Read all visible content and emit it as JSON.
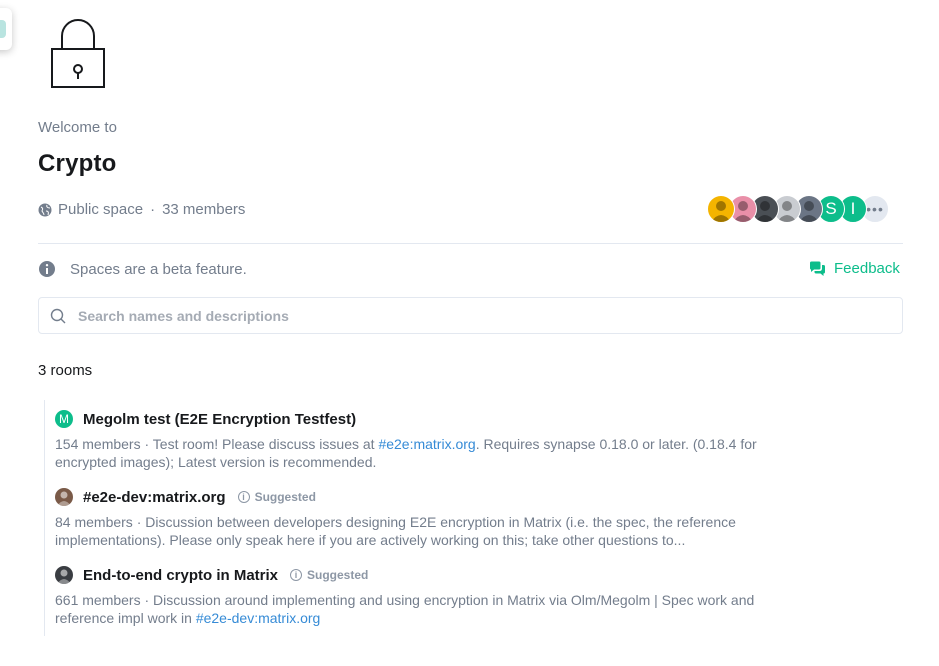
{
  "space": {
    "welcome": "Welcome to",
    "name": "Crypto",
    "visibility": "Public space",
    "separator": "·",
    "members": "33 members"
  },
  "facepile": [
    {
      "letter": "",
      "color": "#f4b400",
      "icon": "user-avatar"
    },
    {
      "letter": "",
      "color": "#e98fa8",
      "icon": "user-avatar"
    },
    {
      "letter": "",
      "color": "#4a4f55",
      "icon": "user-avatar"
    },
    {
      "letter": "",
      "color": "#c9ccd1",
      "icon": "user-avatar"
    },
    {
      "letter": "",
      "color": "#6b7585",
      "icon": "user-avatar"
    },
    {
      "letter": "S",
      "color": "#0dbd8b",
      "icon": "user-avatar"
    },
    {
      "letter": "I",
      "color": "#0dbd8b",
      "icon": "user-avatar"
    },
    {
      "letter": "•••",
      "color": "#e3e8f0",
      "icon": "more-icon"
    }
  ],
  "beta": {
    "text": "Spaces are a beta feature.",
    "feedback_label": "Feedback"
  },
  "search": {
    "placeholder": "Search names and descriptions",
    "value": ""
  },
  "rooms_count": "3 rooms",
  "suggested_label": "Suggested",
  "rooms": [
    {
      "name": "Megolm test (E2E Encryption Testfest)",
      "avatar_letter": "M",
      "avatar_color": "#0dbd8b",
      "suggested": false,
      "desc_before": "154 members · Test room! Please discuss issues at ",
      "desc_link": "#e2e:matrix.org",
      "desc_after": ". Requires synapse 0.18.0 or later. (0.18.4 for encrypted images); Latest version is recommended."
    },
    {
      "name": "#e2e-dev:matrix.org",
      "avatar_letter": "",
      "avatar_color": "#7a5a48",
      "suggested": true,
      "desc_before": "84 members · Discussion between developers designing E2E encryption in Matrix (i.e. the spec, the reference implementations).  Please only speak here if you are actively working on this; take other questions to...",
      "desc_link": "",
      "desc_after": ""
    },
    {
      "name": "End-to-end crypto in Matrix",
      "avatar_letter": "",
      "avatar_color": "#3a3d42",
      "suggested": true,
      "desc_before": "661 members · Discussion around implementing and using encryption in Matrix via Olm/Megolm | Spec work and reference impl work in ",
      "desc_link": "#e2e-dev:matrix.org",
      "desc_after": ""
    }
  ]
}
